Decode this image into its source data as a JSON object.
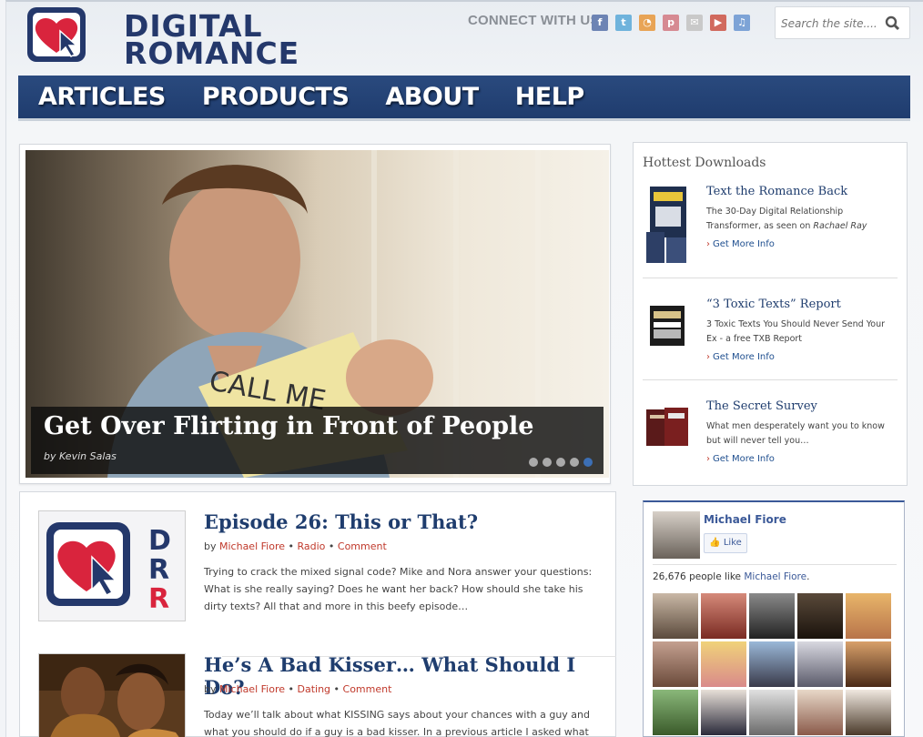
{
  "header": {
    "logo_line1": "DIGITAL",
    "logo_line2": "ROMANCE",
    "connect_label": "CONNECT WITH US",
    "social": [
      {
        "icon": "facebook-icon",
        "glyph": "f",
        "color": "#6d84b4"
      },
      {
        "icon": "twitter-icon",
        "glyph": "t",
        "color": "#6fb3dc"
      },
      {
        "icon": "rss-icon",
        "glyph": "◔",
        "color": "#e8a456"
      },
      {
        "icon": "pinterest-icon",
        "glyph": "p",
        "color": "#d68a92"
      },
      {
        "icon": "email-icon",
        "glyph": "✉",
        "color": "#c9c9c9"
      },
      {
        "icon": "youtube-icon",
        "glyph": "▶",
        "color": "#d16a5e"
      },
      {
        "icon": "itunes-icon",
        "glyph": "♫",
        "color": "#7da3d6"
      }
    ],
    "search_placeholder": "Search the site...."
  },
  "nav": {
    "items": [
      "ARTICLES",
      "PRODUCTS",
      "ABOUT",
      "HELP"
    ]
  },
  "slider": {
    "title": "Get Over Flirting in Front of People",
    "byline": "by Kevin Salas",
    "note_text": "CALL ME",
    "dots": 5,
    "active_dot": 5
  },
  "articles": [
    {
      "title": "Episode 26: This or That?",
      "by": "by",
      "author": "Michael Fiore",
      "category": "Radio",
      "comment": "Comment",
      "excerpt": "Trying to crack the mixed signal code? Mike and Nora answer your questions: What is she really saying? Does he want her back? How should she take his dirty texts? All that and more in this beefy episode…"
    },
    {
      "title": "He’s A Bad Kisser… What Should I Do?",
      "by": "by",
      "author": "Michael Fiore",
      "category": "Dating",
      "comment": "Comment",
      "excerpt": "Today we’ll talk about what KISSING says about your chances with a guy and what you should do if a guy is a bad kisser. In a previous article I asked what"
    }
  ],
  "sidebar": {
    "title": "Hottest Downloads",
    "downloads": [
      {
        "title": "Text the Romance Back",
        "desc": "The 30-Day Digital Relationship Transformer, as seen on",
        "desc_em": "Rachael Ray",
        "more": "Get More Info"
      },
      {
        "title": "“3 Toxic Texts” Report",
        "desc": "3 Toxic Texts You Should Never Send Your Ex - a free TXB Report",
        "desc_em": "",
        "more": "Get More Info"
      },
      {
        "title": "The Secret Survey",
        "desc": "What men desperately want you to know but will never tell you…",
        "desc_em": "",
        "more": "Get More Info"
      }
    ]
  },
  "facebook": {
    "page_name": "Michael Fiore",
    "like_label": "Like",
    "count_text": "26,676 people like",
    "count_link": "Michael Fiore"
  }
}
